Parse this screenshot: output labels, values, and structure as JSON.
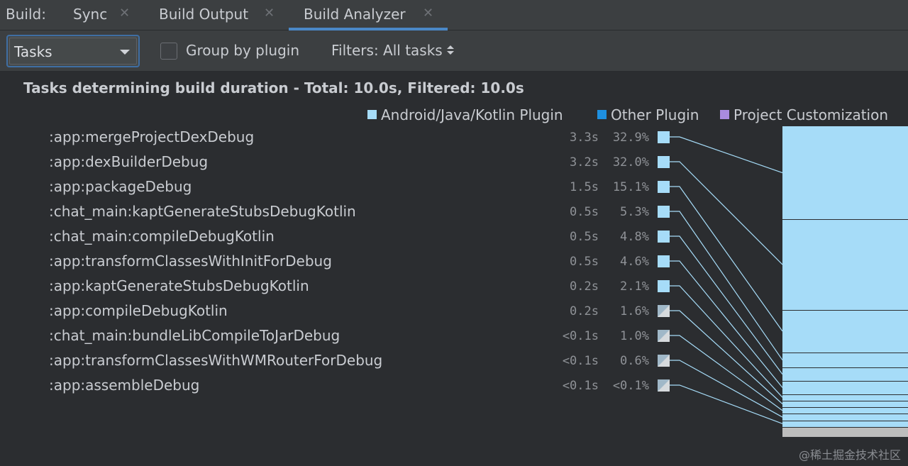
{
  "tabs": {
    "build_label": "Build:",
    "items": [
      {
        "label": "Sync",
        "close": "✕"
      },
      {
        "label": "Build Output",
        "close": "✕"
      },
      {
        "label": "Build Analyzer",
        "close": "✕"
      }
    ],
    "active": "Build Analyzer"
  },
  "toolbar": {
    "view_select": "Tasks",
    "group_by_plugin_label": "Group by plugin",
    "group_by_plugin_checked": false,
    "filters_label": "Filters: All tasks"
  },
  "heading": "Tasks determining build duration - Total: 10.0s, Filtered: 10.0s",
  "legend": [
    {
      "label": "Android/Java/Kotlin Plugin",
      "color": "#a6dcf8"
    },
    {
      "label": "Other Plugin",
      "color": "#1e90e0"
    },
    {
      "label": "Project Customization",
      "color": "#a98be0"
    }
  ],
  "tasks": [
    {
      "name": ":app:mergeProjectDexDebug",
      "time": "3.3s",
      "percent": "32.9%",
      "share": 32.9,
      "type": "plugin"
    },
    {
      "name": ":app:dexBuilderDebug",
      "time": "3.2s",
      "percent": "32.0%",
      "share": 32.0,
      "type": "plugin"
    },
    {
      "name": ":app:packageDebug",
      "time": "1.5s",
      "percent": "15.1%",
      "share": 15.1,
      "type": "plugin"
    },
    {
      "name": ":chat_main:kaptGenerateStubsDebugKotlin",
      "time": "0.5s",
      "percent": "5.3%",
      "share": 5.3,
      "type": "plugin"
    },
    {
      "name": ":chat_main:compileDebugKotlin",
      "time": "0.5s",
      "percent": "4.8%",
      "share": 4.8,
      "type": "plugin"
    },
    {
      "name": ":app:transformClassesWithInitForDebug",
      "time": "0.5s",
      "percent": "4.6%",
      "share": 4.6,
      "type": "plugin"
    },
    {
      "name": ":app:kaptGenerateStubsDebugKotlin",
      "time": "0.2s",
      "percent": "2.1%",
      "share": 2.1,
      "type": "plugin"
    },
    {
      "name": ":app:compileDebugKotlin",
      "time": "0.2s",
      "percent": "1.6%",
      "share": 1.6,
      "type": "mixed"
    },
    {
      "name": ":chat_main:bundleLibCompileToJarDebug",
      "time": "<0.1s",
      "percent": "1.0%",
      "share": 1.0,
      "type": "mixed"
    },
    {
      "name": ":app:transformClassesWithWMRouterForDebug",
      "time": "<0.1s",
      "percent": "0.6%",
      "share": 0.6,
      "type": "mixed"
    },
    {
      "name": ":app:assembleDebug",
      "time": "<0.1s",
      "percent": "<0.1%",
      "share": 0.05,
      "type": "mixed"
    }
  ],
  "other_share": 1.95,
  "watermark": "@稀土掘金技术社区"
}
